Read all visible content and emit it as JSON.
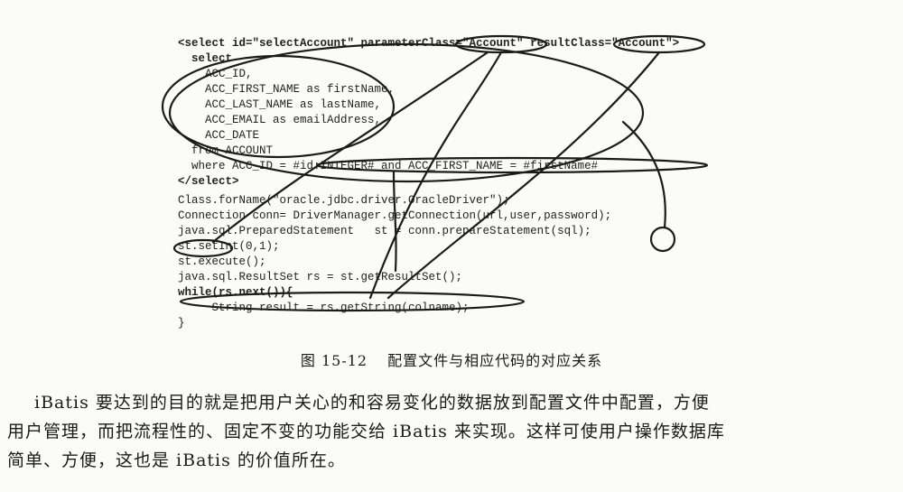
{
  "figure": {
    "xml_lines": [
      "<select id=\"selectAccount\" parameterClass=\"Account\" resultClass=\"Account\">",
      "  select",
      "    ACC_ID,",
      "    ACC_FIRST_NAME as firstName,",
      "    ACC_LAST_NAME as lastName,",
      "    ACC_EMAIL as emailAddress,",
      "    ACC_DATE",
      "  from ACCOUNT",
      "  where ACC_ID = #id:INTEGER# and ACC_FIRST_NAME = #firstName#",
      "</select>"
    ],
    "java_lines": [
      "Class.forName(\"oracle.jdbc.driver.OracleDriver\");",
      "Connection conn= DriverManager.getConnection(url,user,password);",
      "java.sql.PreparedStatement   st = conn.prepareStatement(sql);",
      "st.setInt(0,1);",
      "st.execute();",
      "java.sql.ResultSet rs = st.getResultSet();",
      "while(rs.next()){",
      "     String result = rs.getString(colname);",
      "}"
    ]
  },
  "caption": {
    "number": "图 15-12",
    "text": "配置文件与相应代码的对应关系"
  },
  "body": {
    "line1": "iBatis 要达到的目的就是把用户关心的和容易变化的数据放到配置文件中配置，方便",
    "line2": "用户管理，而把流程性的、固定不变的功能交给 iBatis 来实现。这样可使用户操作数据库",
    "line3": "简单、方便，这也是 iBatis 的价值所在。"
  }
}
